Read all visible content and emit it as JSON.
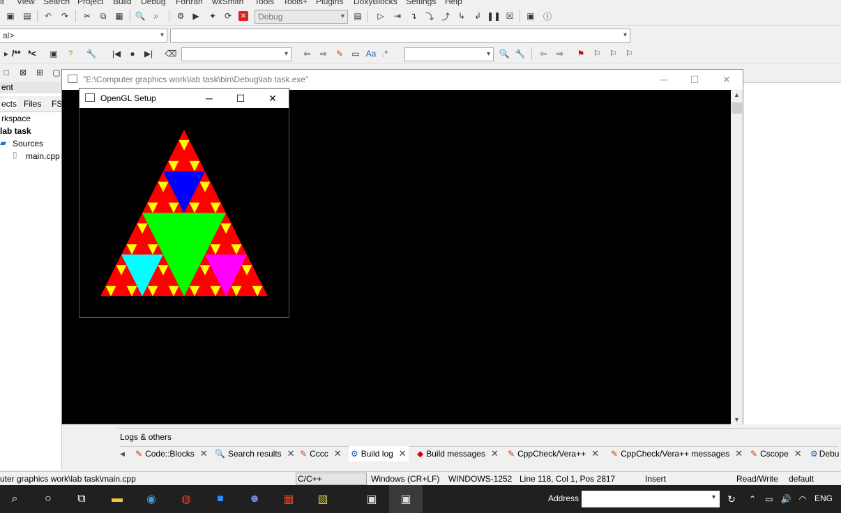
{
  "menu": [
    "it",
    "View",
    "Search",
    "Project",
    "Build",
    "Debug",
    "Fortran",
    "wxSmith",
    "Tools",
    "Tools+",
    "Plugins",
    "DoxyBlocks",
    "Settings",
    "Help"
  ],
  "toolbar": {
    "build_target": "Debug",
    "scope_combo": "al>",
    "comment_block": "/**",
    "comment_line": "*<",
    "regex_label": ".*"
  },
  "left_panel": {
    "header": "ent",
    "tabs": [
      "ects",
      "Files",
      "FS"
    ],
    "tree": {
      "workspace": "rkspace",
      "project": "lab task",
      "folder": "Sources",
      "file": "main.cpp"
    }
  },
  "console_window": {
    "title": "\"E:\\Computer graphics work\\lab task\\bin\\Debug\\lab task.exe\""
  },
  "gl_window": {
    "title": "OpenGL Setup"
  },
  "logs": {
    "header": "Logs & others",
    "tabs": [
      "Code::Blocks",
      "Search results",
      "Cccc",
      "Build log",
      "Build messages",
      "CppCheck/Vera++",
      "CppCheck/Vera++ messages",
      "Cscope",
      "Debu"
    ]
  },
  "status": {
    "path": "uter graphics work\\lab task\\main.cpp",
    "lang": "C/C++",
    "eol": "Windows (CR+LF)",
    "encoding": "WINDOWS-1252",
    "position": "Line 118, Col 1, Pos 2817",
    "mode": "Insert",
    "access": "Read/Write",
    "profile": "default"
  },
  "taskbar": {
    "address_label": "Address",
    "lang": "ENG"
  },
  "colors": {
    "red": "#ff0000",
    "yellow": "#ffff00",
    "blue": "#0000ff",
    "green": "#00ff00",
    "cyan": "#00ffff",
    "magenta": "#ff00ff"
  }
}
